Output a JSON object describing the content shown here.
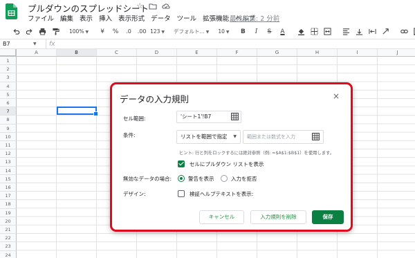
{
  "header": {
    "doc_title": "プルダウンのスプレッドシート",
    "last_edit": "最終編集: 2 分前",
    "menu": [
      "ファイル",
      "編集",
      "表示",
      "挿入",
      "表示形式",
      "データ",
      "ツール",
      "拡張機能",
      "ヘルプ"
    ]
  },
  "toolbar": {
    "zoom": "100%",
    "currency": "¥",
    "percent": "%",
    "decimal_decrease": ".0",
    "decimal_increase": ".00",
    "number_format": "123",
    "font": "デフォルト...",
    "font_size": "10",
    "bold": "B",
    "italic": "I",
    "strike": "S",
    "text_color": "A"
  },
  "formula_bar": {
    "cell_ref": "B7",
    "fx": "fx"
  },
  "grid": {
    "columns": [
      "A",
      "B",
      "C",
      "D",
      "E",
      "F",
      "G",
      "H",
      "I",
      "J"
    ],
    "rows": [
      "1",
      "2",
      "3",
      "4",
      "5",
      "6",
      "7",
      "8",
      "9",
      "10",
      "11",
      "12",
      "13",
      "14",
      "15",
      "16",
      "17",
      "18",
      "19",
      "20",
      "21",
      "22",
      "23",
      "24"
    ],
    "selected_column": "B",
    "selected_row": "7"
  },
  "dialog": {
    "title": "データの入力規則",
    "close": "×",
    "range_label": "セル範囲:",
    "range_value": "'シート1'!B7",
    "criteria_label": "条件:",
    "criteria_select": "リストを範囲で指定",
    "criteria_placeholder": "範囲または数式を入力",
    "hint": "ヒント: 行と列をロックするには絶対参照（例: =$A$1:$B$1）を使用します。",
    "show_dropdown_label": "セルにプルダウン リストを表示",
    "show_dropdown_checked": true,
    "invalid_label": "無効なデータの場合:",
    "invalid_options": [
      "警告を表示",
      "入力を拒否"
    ],
    "invalid_selected": "警告を表示",
    "appearance_label": "デザイン:",
    "help_text_label": "検証ヘルプテキストを表示:",
    "help_text_checked": false,
    "buttons": {
      "cancel": "キャンセル",
      "remove": "入力規則を削除",
      "save": "保存"
    },
    "accent_color": "#0b8043",
    "highlight_border_color": "#e1091e"
  }
}
